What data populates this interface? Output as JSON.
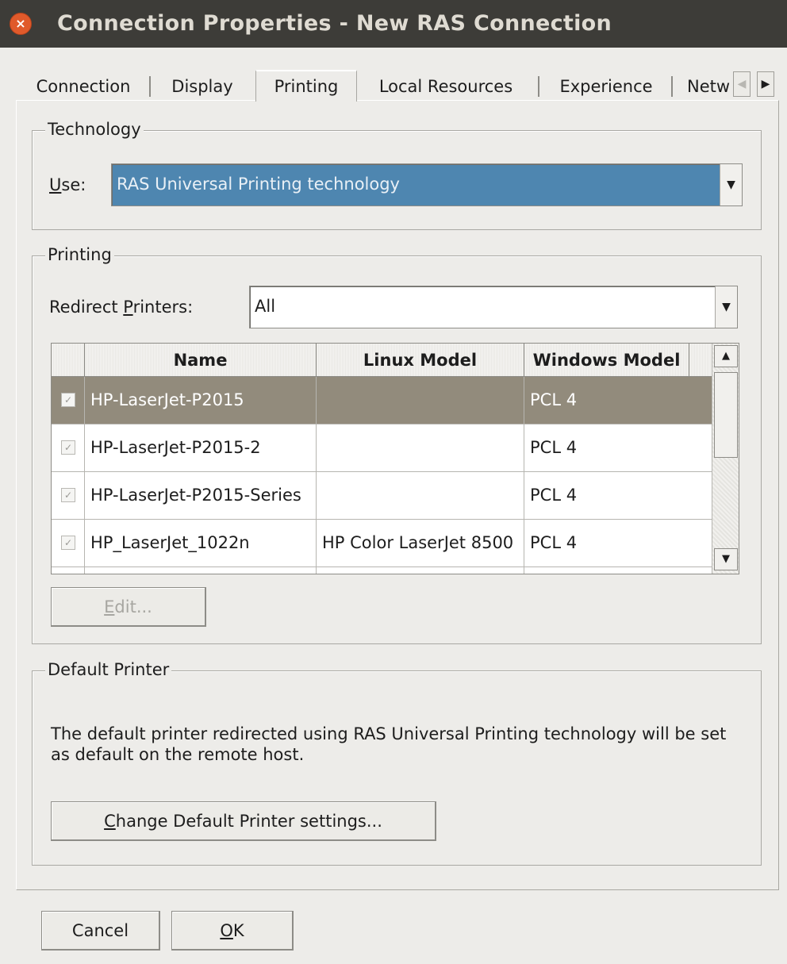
{
  "window": {
    "title": "Connection Properties - New RAS Connection",
    "close_glyph": "×"
  },
  "tabs": [
    {
      "label": "Connection",
      "active": false
    },
    {
      "label": "Display",
      "active": false
    },
    {
      "label": "Printing",
      "active": true
    },
    {
      "label": "Local Resources",
      "active": false
    },
    {
      "label": "Experience",
      "active": false
    },
    {
      "label": "Netw",
      "active": false
    }
  ],
  "tab_scroll": {
    "left": "◀",
    "right": "▶"
  },
  "technology": {
    "legend": "Technology",
    "use_label_mnemonic": "U",
    "use_label_rest": "se:",
    "use_value": "RAS Universal Printing technology"
  },
  "printing": {
    "legend": "Printing",
    "redirect_label_before": "Redirect ",
    "redirect_label_mnemonic": "P",
    "redirect_label_after": "rinters:",
    "redirect_value": "All",
    "columns": {
      "name": "Name",
      "linux_model": "Linux Model",
      "windows_model": "Windows Model"
    },
    "printers": [
      {
        "name": "HP-LaserJet-P2015",
        "linux_model": "",
        "windows_model": "PCL 4",
        "checked": true,
        "selected": true
      },
      {
        "name": "HP-LaserJet-P2015-2",
        "linux_model": "",
        "windows_model": "PCL 4",
        "checked": true,
        "selected": false
      },
      {
        "name": "HP-LaserJet-P2015-Series",
        "linux_model": "",
        "windows_model": "PCL 4",
        "checked": true,
        "selected": false
      },
      {
        "name": "HP_LaserJet_1022n",
        "linux_model": "HP Color LaserJet 8500",
        "windows_model": "PCL 4",
        "checked": true,
        "selected": false
      }
    ],
    "edit_mnemonic": "E",
    "edit_rest": "dit...",
    "dropdown_glyph": "▼",
    "scroll_up_glyph": "▲",
    "scroll_down_glyph": "▼",
    "check_glyph": "✓"
  },
  "default_printer": {
    "legend": "Default Printer",
    "text": "The default printer redirected using RAS Universal Printing technology will be set as default on the remote host.",
    "button_mnemonic": "C",
    "button_rest": "hange Default Printer settings..."
  },
  "footer": {
    "cancel": "Cancel",
    "ok_mnemonic": "O",
    "ok_rest": "K"
  }
}
